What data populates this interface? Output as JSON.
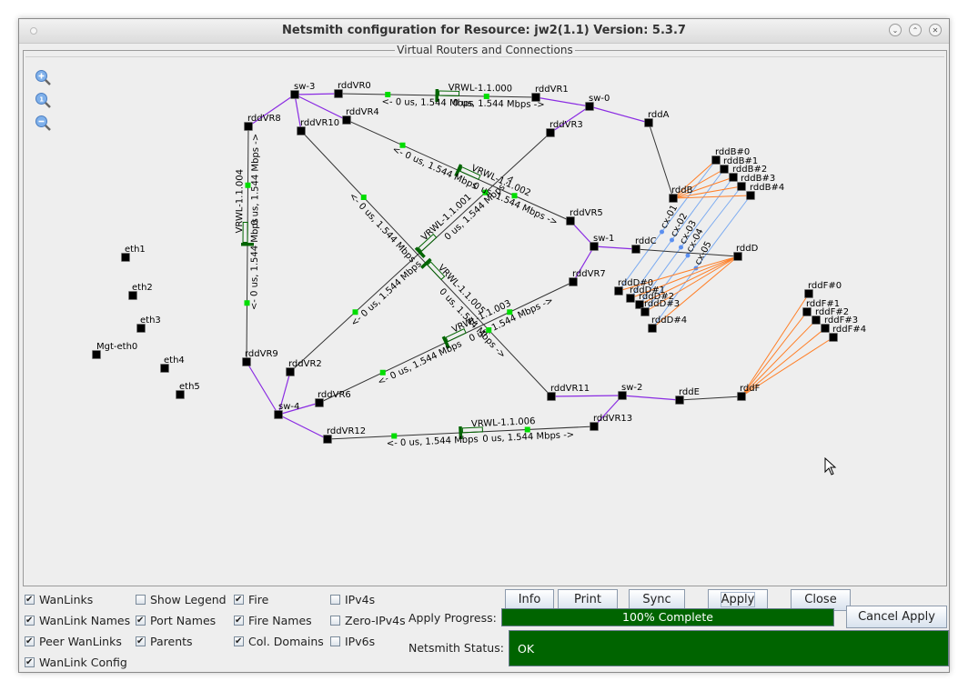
{
  "window": {
    "title": "Netsmith configuration for Resource:  jw2(1.1)  Version: 5.3.7",
    "buttons": [
      {
        "name": "minimize",
        "glyph": "v"
      },
      {
        "name": "maximize",
        "glyph": "^"
      },
      {
        "name": "close",
        "glyph": "x"
      }
    ]
  },
  "panel": {
    "title": "Virtual Routers and Connections",
    "zoom_tools": [
      "zoom-in",
      "zoom-reset",
      "zoom-out"
    ]
  },
  "graph": {
    "colors": {
      "node": "#000000",
      "link": "#333333",
      "switch_link": "#8a2be2",
      "fire": "#ff7f27",
      "collision_domain": "#7aaaf0",
      "wanlink_marker": "#006400",
      "wanlink_midpoint": "#00dd00"
    },
    "nodes": [
      {
        "id": "sw-3",
        "label": "sw-3"
      },
      {
        "id": "rddVR0",
        "label": "rddVR0"
      },
      {
        "id": "rddVR1",
        "label": "rddVR1"
      },
      {
        "id": "sw-0",
        "label": "sw-0"
      },
      {
        "id": "rddA",
        "label": "rddA"
      },
      {
        "id": "rddVR8",
        "label": "rddVR8"
      },
      {
        "id": "rddVR10",
        "label": "rddVR10"
      },
      {
        "id": "rddVR4",
        "label": "rddVR4"
      },
      {
        "id": "rddVR3",
        "label": "rddVR3"
      },
      {
        "id": "rddB",
        "label": "rddB"
      },
      {
        "id": "rddB#0",
        "label": "rddB#0"
      },
      {
        "id": "rddB#1",
        "label": "rddB#1"
      },
      {
        "id": "rddB#2",
        "label": "rddB#2"
      },
      {
        "id": "rddB#3",
        "label": "rddB#3"
      },
      {
        "id": "rddB#4",
        "label": "rddB#4"
      },
      {
        "id": "rddVR5",
        "label": "rddVR5"
      },
      {
        "id": "sw-1",
        "label": "sw-1"
      },
      {
        "id": "rddC",
        "label": "rddC"
      },
      {
        "id": "rddD",
        "label": "rddD"
      },
      {
        "id": "rddVR7",
        "label": "rddVR7"
      },
      {
        "id": "rddD#0",
        "label": "rddD#0"
      },
      {
        "id": "rddD#1",
        "label": "rddD#1"
      },
      {
        "id": "rddD#2",
        "label": "rddD#2"
      },
      {
        "id": "rddD#3",
        "label": "rddD#3"
      },
      {
        "id": "rddD#4",
        "label": "rddD#4"
      },
      {
        "id": "rddF#0",
        "label": "rddF#0"
      },
      {
        "id": "rddF#1",
        "label": "rddF#1"
      },
      {
        "id": "rddF#2",
        "label": "rddF#2"
      },
      {
        "id": "rddF#3",
        "label": "rddF#3"
      },
      {
        "id": "rddF#4",
        "label": "rddF#4"
      },
      {
        "id": "eth1",
        "label": "eth1"
      },
      {
        "id": "eth2",
        "label": "eth2"
      },
      {
        "id": "eth3",
        "label": "eth3"
      },
      {
        "id": "Mgt-eth0",
        "label": "Mgt-eth0"
      },
      {
        "id": "eth4",
        "label": "eth4"
      },
      {
        "id": "eth5",
        "label": "eth5"
      },
      {
        "id": "rddVR9",
        "label": "rddVR9"
      },
      {
        "id": "rddVR2",
        "label": "rddVR2"
      },
      {
        "id": "rddVR6",
        "label": "rddVR6"
      },
      {
        "id": "sw-4",
        "label": "sw-4"
      },
      {
        "id": "rddVR12",
        "label": "rddVR12"
      },
      {
        "id": "rddVR13",
        "label": "rddVR13"
      },
      {
        "id": "rddVR11",
        "label": "rddVR11"
      },
      {
        "id": "sw-2",
        "label": "sw-2"
      },
      {
        "id": "rddE",
        "label": "rddE"
      },
      {
        "id": "rddF",
        "label": "rddF"
      }
    ],
    "switch_links": [
      [
        "sw-3",
        "rddVR0"
      ],
      [
        "sw-3",
        "rddVR8"
      ],
      [
        "sw-3",
        "rddVR10"
      ],
      [
        "sw-3",
        "rddVR4"
      ],
      [
        "sw-0",
        "rddVR1"
      ],
      [
        "sw-0",
        "rddVR3"
      ],
      [
        "sw-0",
        "rddA"
      ],
      [
        "sw-1",
        "rddVR5"
      ],
      [
        "sw-1",
        "rddVR7"
      ],
      [
        "sw-1",
        "rddC"
      ],
      [
        "sw-2",
        "rddVR11"
      ],
      [
        "sw-2",
        "rddVR13"
      ],
      [
        "sw-2",
        "rddE"
      ],
      [
        "sw-4",
        "rddVR9"
      ],
      [
        "sw-4",
        "rddVR2"
      ],
      [
        "sw-4",
        "rddVR6"
      ],
      [
        "sw-4",
        "rddVR12"
      ]
    ],
    "plain_links": [
      [
        "rddA",
        "rddB"
      ],
      [
        "rddC",
        "rddD"
      ],
      [
        "rddE",
        "rddF"
      ]
    ],
    "wanlinks": [
      {
        "name": "VRWL-1.1.000",
        "a": "rddVR0",
        "b": "rddVR1",
        "a_label": "<- 0 us, 1.544 Mbps",
        "b_label": "0 us, 1.544 Mbps ->"
      },
      {
        "name": "VRWL-1.1.001",
        "a": "rddVR2",
        "b": "rddVR3",
        "a_label": "<- 0 us, 1.544 Mbps",
        "b_label": "0 us, 1.544 Mbps ->"
      },
      {
        "name": "VRWL-1.1.002",
        "a": "rddVR4",
        "b": "rddVR5",
        "a_label": "<- 0 us, 1.544 Mbps",
        "b_label": "0 us, 1.544 Mbps ->"
      },
      {
        "name": "VRWL-1.1.003",
        "a": "rddVR6",
        "b": "rddVR7",
        "a_label": "<- 0 us, 1.544 Mbps",
        "b_label": "0 us, 1.544 Mbps ->"
      },
      {
        "name": "VRWL-1.1.004",
        "a": "rddVR9",
        "b": "rddVR8",
        "a_label": "<- 0 us, 1.544 Mbps",
        "b_label": "0 us, 1.544 Mbps ->"
      },
      {
        "name": "VRWL-1.1.005",
        "a": "rddVR10",
        "b": "rddVR11",
        "a_label": "<- 0 us, 1.544 Mbps",
        "b_label": "0 us, 1.544 Mbps ->"
      },
      {
        "name": "VRWL-1.1.006",
        "a": "rddVR12",
        "b": "rddVR13",
        "a_label": "<- 0 us, 1.544 Mbps",
        "b_label": "0 us, 1.544 Mbps ->"
      }
    ],
    "fire_links": [
      [
        "rddB",
        "rddB#0"
      ],
      [
        "rddB",
        "rddB#1"
      ],
      [
        "rddB",
        "rddB#2"
      ],
      [
        "rddB",
        "rddB#3"
      ],
      [
        "rddB",
        "rddB#4"
      ],
      [
        "rddD",
        "rddD#0"
      ],
      [
        "rddD",
        "rddD#1"
      ],
      [
        "rddD",
        "rddD#2"
      ],
      [
        "rddD",
        "rddD#3"
      ],
      [
        "rddD",
        "rddD#4"
      ],
      [
        "rddF",
        "rddF#0"
      ],
      [
        "rddF",
        "rddF#1"
      ],
      [
        "rddF",
        "rddF#2"
      ],
      [
        "rddF",
        "rddF#3"
      ],
      [
        "rddF",
        "rddF#4"
      ]
    ],
    "collision_domains": [
      {
        "name": "cx-01",
        "a": "rddB#0",
        "b": "rddD#0"
      },
      {
        "name": "cx-02",
        "a": "rddB#1",
        "b": "rddD#1"
      },
      {
        "name": "cx-03",
        "a": "rddB#2",
        "b": "rddD#2"
      },
      {
        "name": "cx-04",
        "a": "rddB#3",
        "b": "rddD#3"
      },
      {
        "name": "cx-05",
        "a": "rddB#4",
        "b": "rddD#4"
      }
    ]
  },
  "options": {
    "checkboxes": [
      {
        "label": "WanLinks",
        "checked": true
      },
      {
        "label": "WanLink Names",
        "checked": true
      },
      {
        "label": "Peer WanLinks",
        "checked": true
      },
      {
        "label": "WanLink Config",
        "checked": true
      },
      {
        "label": "Show Legend",
        "checked": false
      },
      {
        "label": "Port Names",
        "checked": true
      },
      {
        "label": "Parents",
        "checked": true
      },
      {
        "label": "Fire",
        "checked": true
      },
      {
        "label": "Fire Names",
        "checked": true
      },
      {
        "label": "Col. Domains",
        "checked": true
      },
      {
        "label": "IPv4s",
        "checked": false
      },
      {
        "label": "Zero-IPv4s",
        "checked": false
      },
      {
        "label": "IPv6s",
        "checked": false
      }
    ]
  },
  "actions": {
    "info": "Info",
    "print": "Print",
    "sync": "Sync",
    "apply": "Apply",
    "close": "Close",
    "cancel_apply": "Cancel Apply"
  },
  "progress": {
    "label": "Apply Progress:",
    "percent": 100,
    "text": "100% Complete"
  },
  "status": {
    "label": "Netsmith Status:",
    "text": "OK"
  }
}
